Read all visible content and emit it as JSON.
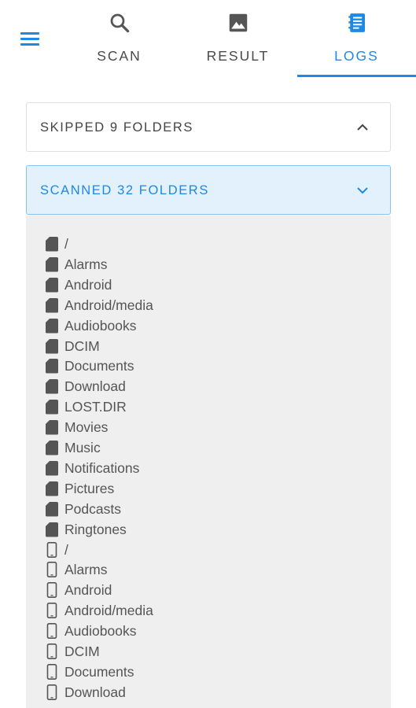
{
  "appbar": {
    "menu_icon": "hamburger-menu-icon",
    "tabs": [
      {
        "label": "SCAN",
        "icon": "search-icon",
        "active": false
      },
      {
        "label": "RESULT",
        "icon": "image-icon",
        "active": false
      },
      {
        "label": "LOGS",
        "icon": "logs-icon",
        "active": true
      }
    ]
  },
  "panels": {
    "skipped": {
      "label": "SKIPPED 9 FOLDERS",
      "expanded": false
    },
    "scanned": {
      "label": "SCANNED 32 FOLDERS",
      "expanded": true
    }
  },
  "scanned_folders": [
    {
      "name": "/",
      "storage": "sd-card-icon"
    },
    {
      "name": "Alarms",
      "storage": "sd-card-icon"
    },
    {
      "name": "Android",
      "storage": "sd-card-icon"
    },
    {
      "name": "Android/media",
      "storage": "sd-card-icon"
    },
    {
      "name": "Audiobooks",
      "storage": "sd-card-icon"
    },
    {
      "name": "DCIM",
      "storage": "sd-card-icon"
    },
    {
      "name": "Documents",
      "storage": "sd-card-icon"
    },
    {
      "name": "Download",
      "storage": "sd-card-icon"
    },
    {
      "name": "LOST.DIR",
      "storage": "sd-card-icon"
    },
    {
      "name": "Movies",
      "storage": "sd-card-icon"
    },
    {
      "name": "Music",
      "storage": "sd-card-icon"
    },
    {
      "name": "Notifications",
      "storage": "sd-card-icon"
    },
    {
      "name": "Pictures",
      "storage": "sd-card-icon"
    },
    {
      "name": "Podcasts",
      "storage": "sd-card-icon"
    },
    {
      "name": "Ringtones",
      "storage": "sd-card-icon"
    },
    {
      "name": "/",
      "storage": "phone-icon"
    },
    {
      "name": "Alarms",
      "storage": "phone-icon"
    },
    {
      "name": "Android",
      "storage": "phone-icon"
    },
    {
      "name": "Android/media",
      "storage": "phone-icon"
    },
    {
      "name": "Audiobooks",
      "storage": "phone-icon"
    },
    {
      "name": "DCIM",
      "storage": "phone-icon"
    },
    {
      "name": "Documents",
      "storage": "phone-icon"
    },
    {
      "name": "Download",
      "storage": "phone-icon"
    }
  ],
  "colors": {
    "accent": "#1e88e5",
    "text": "#444444",
    "list_bg": "#efefef"
  }
}
